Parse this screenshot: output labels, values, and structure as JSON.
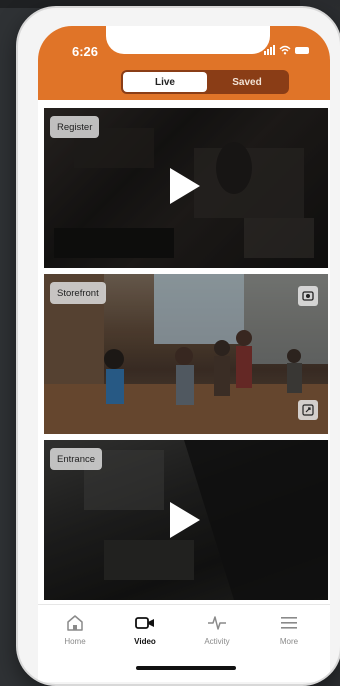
{
  "status_bar": {
    "time": "6:26"
  },
  "segment": {
    "live_label": "Live",
    "saved_label": "Saved",
    "selected": "Live"
  },
  "feeds": [
    {
      "label": "Register",
      "state": "paused"
    },
    {
      "label": "Storefront",
      "state": "playing"
    },
    {
      "label": "Entrance",
      "state": "paused"
    }
  ],
  "tabbar": {
    "items": [
      {
        "label": "Home",
        "icon": "home-icon"
      },
      {
        "label": "Video",
        "icon": "video-camera-icon",
        "active": true
      },
      {
        "label": "Activity",
        "icon": "activity-pulse-icon"
      },
      {
        "label": "More",
        "icon": "menu-icon"
      }
    ]
  },
  "colors": {
    "header": "#e07428",
    "segment_bg": "#8a3d16"
  }
}
